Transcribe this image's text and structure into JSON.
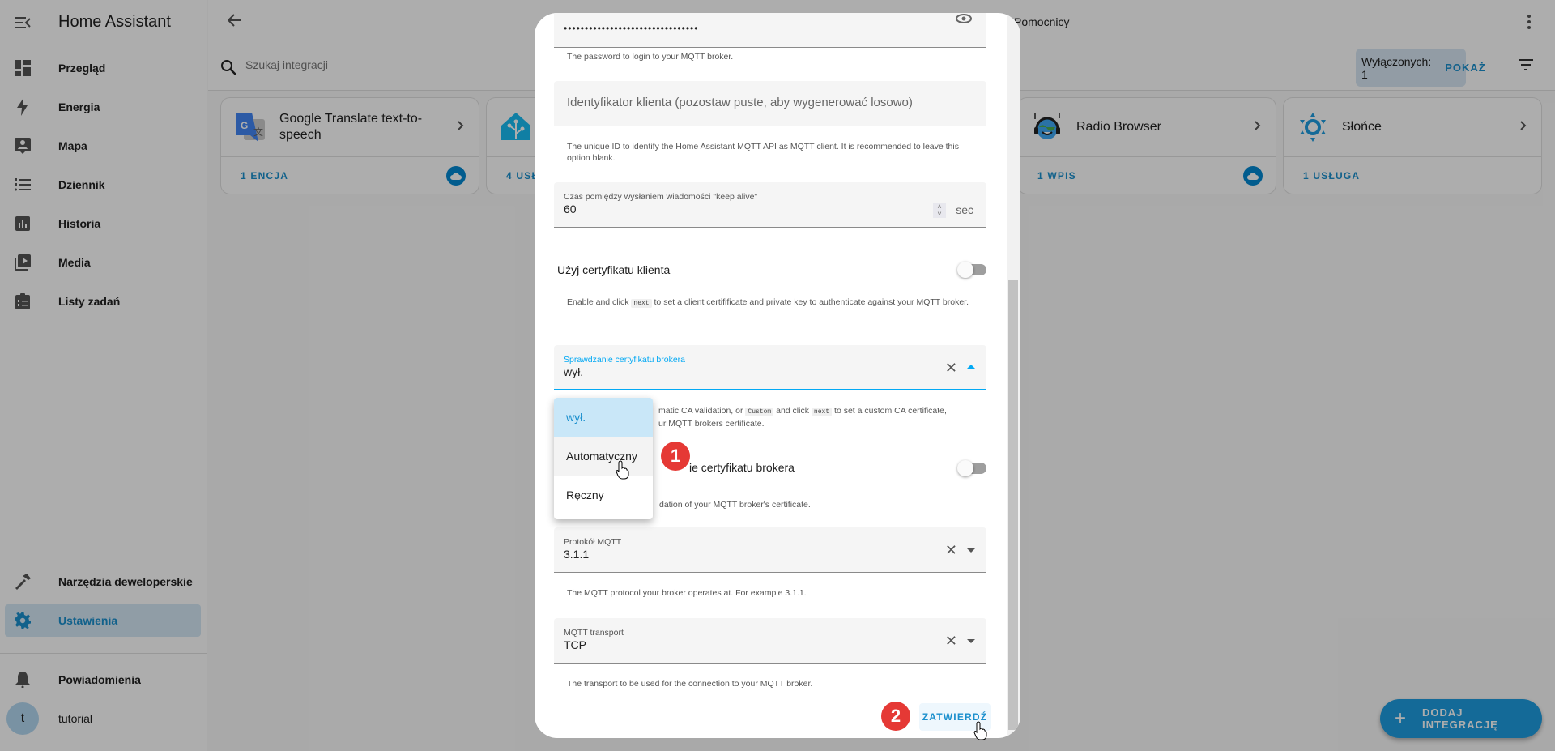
{
  "sidebar": {
    "title": "Home Assistant",
    "items": [
      {
        "label": "Przegląd",
        "icon": "dashboard-icon"
      },
      {
        "label": "Energia",
        "icon": "lightning-icon"
      },
      {
        "label": "Mapa",
        "icon": "map-person-icon"
      },
      {
        "label": "Dziennik",
        "icon": "list-icon"
      },
      {
        "label": "Historia",
        "icon": "chart-icon"
      },
      {
        "label": "Media",
        "icon": "media-play-icon"
      },
      {
        "label": "Listy zadań",
        "icon": "clipboard-list-icon"
      }
    ],
    "dev_tools": "Narzędzia deweloperskie",
    "settings": "Ustawienia",
    "notifications": "Powiadomienia",
    "user": {
      "initial": "t",
      "name": "tutorial"
    }
  },
  "topbar": {
    "breadcrumb": "Pomocnicy"
  },
  "search": {
    "placeholder": "Szukaj integracji",
    "disabled_label": "Wyłączonych: 1",
    "show_label": "POKAŻ"
  },
  "cards": [
    {
      "name": "Google Translate text-to-speech",
      "count": "1 ENCJA",
      "cloud": true
    },
    {
      "name": "",
      "count": "4 USŁ",
      "cloud": false
    },
    {
      "name": "Radio Browser",
      "count": "1 WPIS",
      "cloud": true
    },
    {
      "name": "Słońce",
      "count": "1 USŁUGA",
      "cloud": false
    }
  ],
  "fab_label": "DODAJ INTEGRACJĘ",
  "dialog": {
    "password_mask": "••••••••••••••••••••••••••••••••",
    "password_help": "The password to login to your MQTT broker.",
    "client_id_placeholder": "Identyfikator klienta (pozostaw puste, aby wygenerować losowo)",
    "client_id_help": "The unique ID to identify the Home Assistant MQTT API as MQTT client. It is recommended to leave this option blank.",
    "keepalive_label": "Czas pomiędzy wysłaniem wiadomości \"keep alive\"",
    "keepalive_value": "60",
    "keepalive_unit": "sec",
    "client_cert_label": "Użyj certyfikatu klienta",
    "client_cert_help_pre": "Enable and click",
    "client_cert_help_code": "next",
    "client_cert_help_post": "to set a client certifificate and private key to authenticate against your MQTT broker.",
    "broker_cert_label": "Sprawdzanie certyfikatu brokera",
    "broker_cert_value": "wył.",
    "broker_cert_help_a": "matic CA validation, or",
    "broker_cert_help_code1": "Custom",
    "broker_cert_help_b": "and click",
    "broker_cert_help_code2": "next",
    "broker_cert_help_c": "to set a custom CA certificate,",
    "broker_cert_help_line2": "ur MQTT brokers certificate.",
    "ignore_cert_label": "ie certyfikatu brokera",
    "ignore_cert_help": "dation of your MQTT broker's certificate.",
    "protocol_label": "Protokół MQTT",
    "protocol_value": "3.1.1",
    "protocol_help": "The MQTT protocol your broker operates at. For example 3.1.1.",
    "transport_label": "MQTT transport",
    "transport_value": "TCP",
    "transport_help": "The transport to be used for the connection to your MQTT broker.",
    "submit_label": "ZATWIERDŹ"
  },
  "dropdown": {
    "options": [
      "wył.",
      "Automatyczny",
      "Ręczny"
    ],
    "selected": "wył."
  },
  "annotations": [
    "1",
    "2"
  ]
}
